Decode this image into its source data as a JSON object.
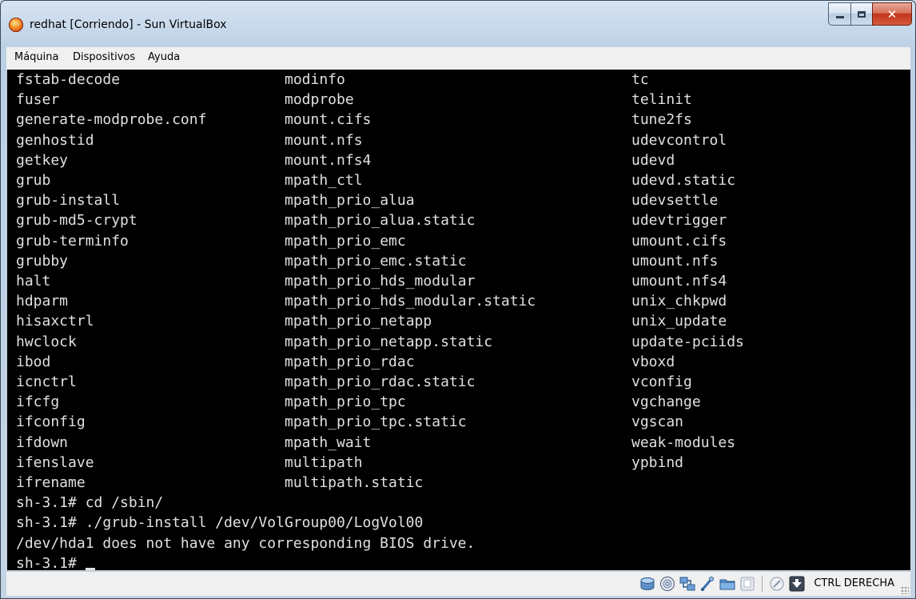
{
  "window": {
    "title": "redhat [Corriendo] - Sun VirtualBox"
  },
  "menu": [
    "Máquina",
    "Dispositivos",
    "Ayuda"
  ],
  "terminal": {
    "columns": [
      [
        "fstab-decode",
        "fuser",
        "generate-modprobe.conf",
        "genhostid",
        "getkey",
        "grub",
        "grub-install",
        "grub-md5-crypt",
        "grub-terminfo",
        "grubby",
        "halt",
        "hdparm",
        "hisaxctrl",
        "hwclock",
        "ibod",
        "icnctrl",
        "ifcfg",
        "ifconfig",
        "ifdown",
        "ifenslave",
        "ifrename"
      ],
      [
        "modinfo",
        "modprobe",
        "mount.cifs",
        "mount.nfs",
        "mount.nfs4",
        "mpath_ctl",
        "mpath_prio_alua",
        "mpath_prio_alua.static",
        "mpath_prio_emc",
        "mpath_prio_emc.static",
        "mpath_prio_hds_modular",
        "mpath_prio_hds_modular.static",
        "mpath_prio_netapp",
        "mpath_prio_netapp.static",
        "mpath_prio_rdac",
        "mpath_prio_rdac.static",
        "mpath_prio_tpc",
        "mpath_prio_tpc.static",
        "mpath_wait",
        "multipath",
        "multipath.static"
      ],
      [
        "tc",
        "telinit",
        "tune2fs",
        "udevcontrol",
        "udevd",
        "udevd.static",
        "udevsettle",
        "udevtrigger",
        "umount.cifs",
        "umount.nfs",
        "umount.nfs4",
        "unix_chkpwd",
        "unix_update",
        "update-pciids",
        "vboxd",
        "vconfig",
        "vgchange",
        "vgscan",
        "weak-modules",
        "ypbind"
      ]
    ],
    "lines": [
      "sh-3.1# cd /sbin/",
      "sh-3.1# ./grub-install /dev/VolGroup00/LogVol00",
      "/dev/hda1 does not have any corresponding BIOS drive.",
      "sh-3.1# "
    ]
  },
  "status": {
    "icons": [
      "hard-disk-icon",
      "cd-dvd-icon",
      "network-icon",
      "usb-icon",
      "shared-folder-icon",
      "display-icon",
      "mouse-integration-icon",
      "host-key-arrow-icon"
    ],
    "host_key": "CTRL DERECHA"
  }
}
